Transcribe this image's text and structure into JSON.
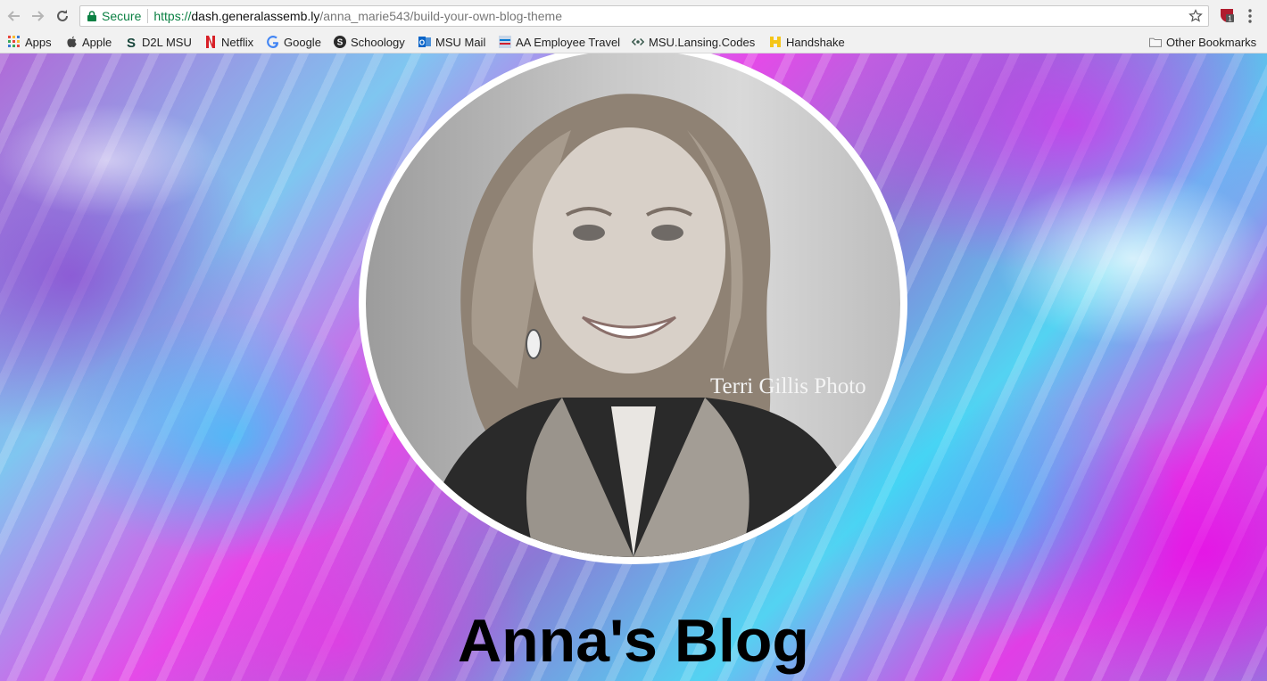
{
  "browser": {
    "security_label": "Secure",
    "url_scheme": "https://",
    "url_host": "dash.generalassemb.ly",
    "url_path": "/anna_marie543/build-your-own-blog-theme",
    "extension_badge": "1"
  },
  "bookmarks": [
    {
      "label": "Apps",
      "icon": "apps-grid-icon"
    },
    {
      "label": "Apple",
      "icon": "apple-icon"
    },
    {
      "label": "D2L MSU",
      "icon": "msu-s-icon"
    },
    {
      "label": "Netflix",
      "icon": "netflix-icon"
    },
    {
      "label": "Google",
      "icon": "google-icon"
    },
    {
      "label": "Schoology",
      "icon": "schoology-icon"
    },
    {
      "label": "MSU Mail",
      "icon": "outlook-icon"
    },
    {
      "label": "AA Employee Travel",
      "icon": "aa-icon"
    },
    {
      "label": "MSU.Lansing.Codes",
      "icon": "codes-icon"
    },
    {
      "label": "Handshake",
      "icon": "handshake-icon"
    }
  ],
  "other_bookmarks": "Other Bookmarks",
  "page": {
    "photo_watermark": "Terri Gillis Photo",
    "blog_title": "Anna's Blog"
  },
  "colors": {
    "secure_green": "#0b8043",
    "background_magenta": "#e54ae8",
    "background_cyan": "#53d3f2",
    "title": "#000000"
  }
}
